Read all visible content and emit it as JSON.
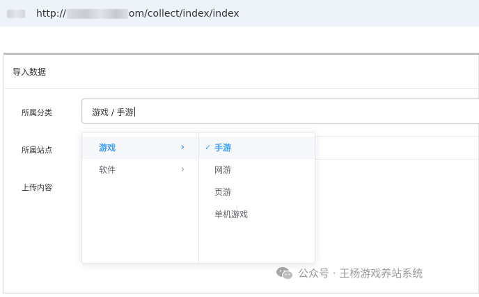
{
  "browser": {
    "url_prefix": "http://",
    "url_suffix": "om/collect/index/index"
  },
  "card": {
    "title": "导入数据"
  },
  "form": {
    "category_label": "所属分类",
    "category_value": "游戏 / 手游",
    "site_label": "所属站点",
    "content_label": "上传内容"
  },
  "cascader": {
    "level1": [
      {
        "label": "游戏",
        "active": true
      },
      {
        "label": "软件",
        "active": false
      }
    ],
    "level2": [
      {
        "label": "手游",
        "selected": true
      },
      {
        "label": "网游",
        "selected": false
      },
      {
        "label": "页游",
        "selected": false
      },
      {
        "label": "单机游戏",
        "selected": false
      }
    ],
    "arrow_icon": "chevron-right-icon",
    "check_icon": "check-icon"
  },
  "watermark": {
    "text": "公众号 · 王杨游戏养站系统",
    "icon": "wechat-icon"
  },
  "colors": {
    "accent": "#409eff",
    "address_bar": "#eef2f9",
    "watermark": "#9a9a9a"
  }
}
